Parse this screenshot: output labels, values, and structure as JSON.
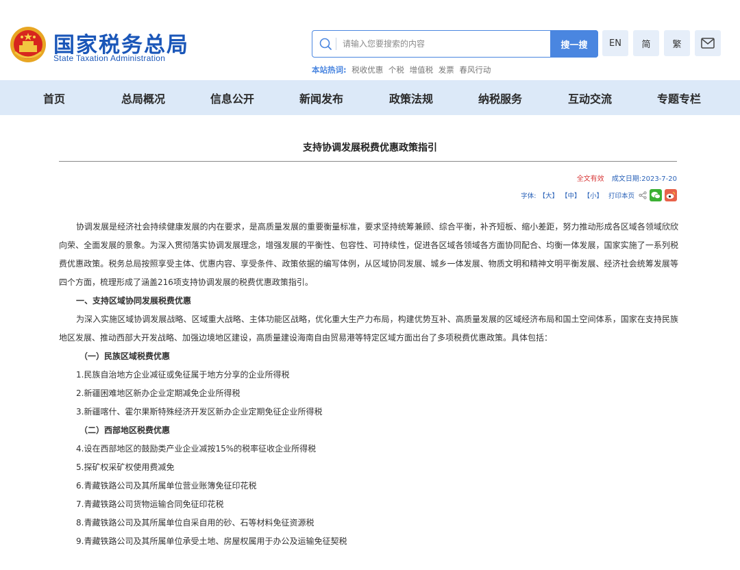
{
  "header": {
    "logo_cn": "国家税务总局",
    "logo_en": "State Taxation Administration",
    "search_placeholder": "请输入您要搜索的内容",
    "search_button": "搜一搜",
    "lang_en": "EN",
    "lang_simplified": "简",
    "lang_traditional": "繁",
    "hot_label": "本站热词:",
    "hot_words": [
      "税收优惠",
      "个税",
      "增值税",
      "发票",
      "春风行动"
    ]
  },
  "nav": {
    "items": [
      "首页",
      "总局概况",
      "信息公开",
      "新闻发布",
      "政策法规",
      "纳税服务",
      "互动交流",
      "专题专栏"
    ]
  },
  "article": {
    "title": "支持协调发展税费优惠政策指引",
    "validity": "全文有效",
    "date": "成文日期:2023-7-20",
    "font_label": "字体:",
    "font_large": "【大】",
    "font_medium": "【中】",
    "font_small": "【小】",
    "print": "打印本页",
    "intro": "协调发展是经济社会持续健康发展的内在要求，是高质量发展的重要衡量标准，要求坚持统筹兼顾、综合平衡，补齐短板、缩小差距，努力推动形成各区域各领域欣欣向荣、全面发展的景象。为深入贯彻落实协调发展理念，增强发展的平衡性、包容性、可持续性，促进各区域各领域各方面协同配合、均衡一体发展，国家实施了一系列税费优惠政策。税务总局按照享受主体、优惠内容、享受条件、政策依据的编写体例，从区域协同发展、城乡一体发展、物质文明和精神文明平衡发展、经济社会统筹发展等四个方面，梳理形成了涵盖216项支持协调发展的税费优惠政策指引。",
    "section1_title": "一、支持区域协同发展税费优惠",
    "section1_para": "为深入实施区域协调发展战略、区域重大战略、主体功能区战略，优化重大生产力布局，构建优势互补、高质量发展的区域经济布局和国土空间体系，国家在支持民族地区发展、推动西部大开发战略、加强边境地区建设，高质量建设海南自由贸易港等特定区域方面出台了多项税费优惠政策。具体包括：",
    "sub1_title": "（一）民族区域税费优惠",
    "sub1_items": [
      "1.民族自治地方企业减征或免征属于地方分享的企业所得税",
      "2.新疆困难地区新办企业定期减免企业所得税",
      "3.新疆喀什、霍尔果斯特殊经济开发区新办企业定期免征企业所得税"
    ],
    "sub2_title": "（二）西部地区税费优惠",
    "sub2_items": [
      "4.设在西部地区的鼓励类产业企业减按15%的税率征收企业所得税",
      "5.探矿权采矿权使用费减免",
      "6.青藏铁路公司及其所属单位营业账簿免征印花税",
      "7.青藏铁路公司货物运输合同免征印花税",
      "8.青藏铁路公司及其所属单位自采自用的砂、石等材料免征资源税",
      "9.青藏铁路公司及其所属单位承受土地、房屋权属用于办公及运输免征契税"
    ]
  }
}
